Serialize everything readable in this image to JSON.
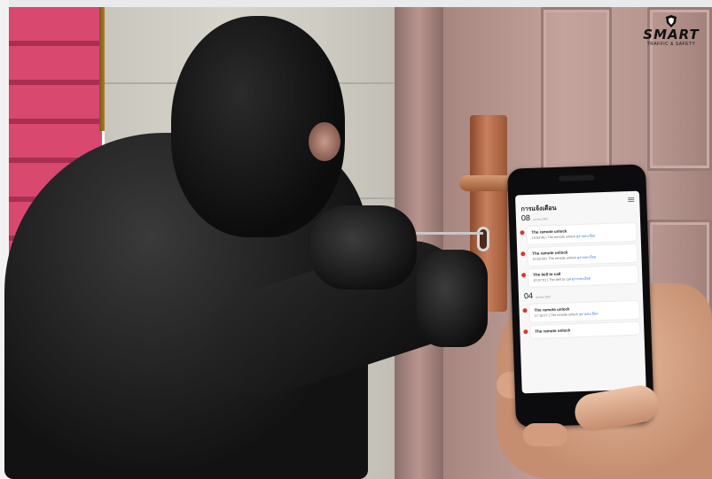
{
  "logo": {
    "name": "SMART",
    "tagline": "TRAFFIC & SAFETY"
  },
  "phone": {
    "app_title": "การแจ้งเตือน",
    "days": [
      {
        "day": "08",
        "sub": "ตุลาคม 2567",
        "events": [
          {
            "title": "The remote unlock",
            "detail": "10:53:46 | The remote unlock",
            "link": "ดูรายละเอียด"
          },
          {
            "title": "The remote unlock",
            "detail": "10:52:59 | The remote unlock",
            "link": "ดูรายละเอียด"
          },
          {
            "title": "The bell to call",
            "detail": "10:37:01 | The bell to call",
            "link": "ดูรายละเอียด"
          }
        ]
      },
      {
        "day": "04",
        "sub": "ตุลาคม 2567",
        "events": [
          {
            "title": "The remote unlock",
            "detail": "17:15:07 | The remote unlock",
            "link": "ดูรายละเอียด"
          },
          {
            "title": "The remote unlock",
            "detail": "",
            "link": ""
          }
        ]
      }
    ]
  },
  "colors": {
    "alert_dot": "#d33a2c",
    "link": "#2f6fd6"
  }
}
